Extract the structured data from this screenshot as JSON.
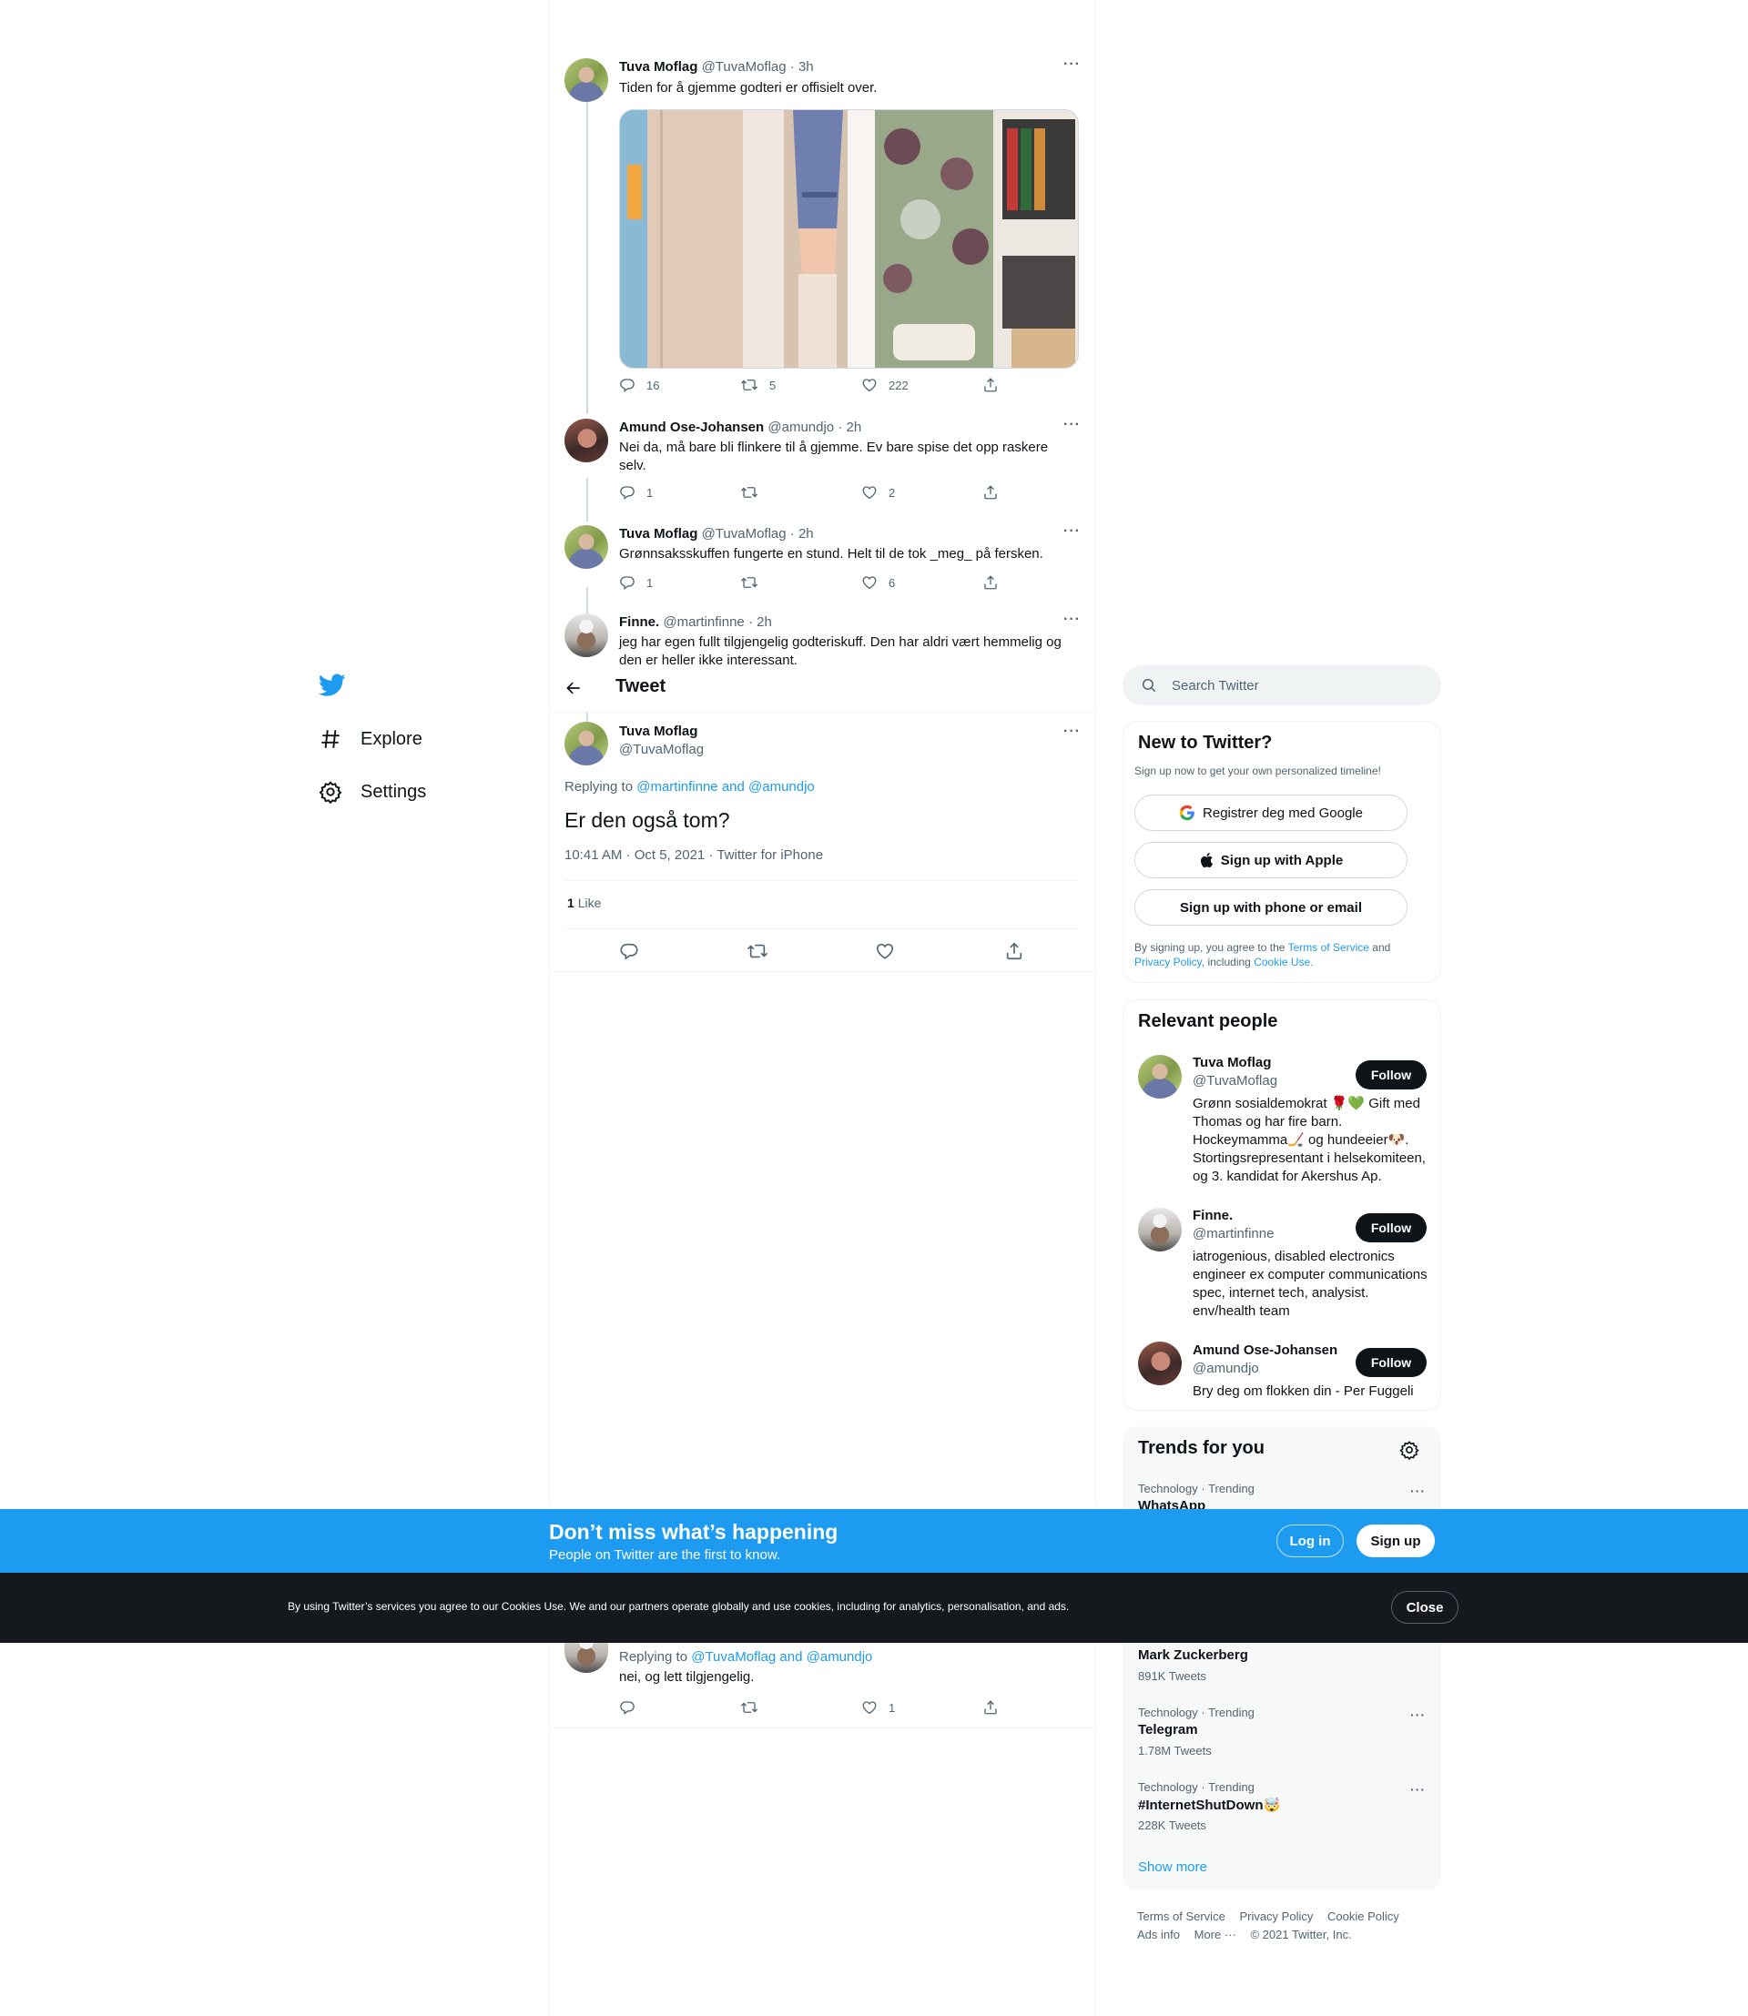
{
  "nav": {
    "explore": "Explore",
    "settings": "Settings"
  },
  "header": {
    "title": "Tweet"
  },
  "thread": [
    {
      "name": "Tuva Moflag",
      "handle": "@TuvaMoflag",
      "time": "· 3h",
      "text": "Tiden for å gjemme godteri er offisielt over.",
      "replies": "16",
      "retweets": "5",
      "likes": "222"
    },
    {
      "name": "Amund Ose-Johansen",
      "handle": "@amundjo",
      "time": "· 2h",
      "text": "Nei da, må bare bli flinkere til å gjemme. Ev bare spise det opp raskere selv.",
      "replies": "1",
      "retweets": "",
      "likes": "2"
    },
    {
      "name": "Tuva Moflag",
      "handle": "@TuvaMoflag",
      "time": "· 2h",
      "text": "Grønnsaksskuffen fungerte en stund. Helt til de tok _meg_ på fersken.",
      "replies": "1",
      "retweets": "",
      "likes": "6"
    },
    {
      "name": "Finne.",
      "handle": "@martinfinne",
      "time": "· 2h",
      "text": "jeg har egen fullt tilgjengelig godteriskuff. Den har aldri vært hemmelig og den er heller ikke interessant."
    }
  ],
  "main_tweet": {
    "name": "Tuva Moflag",
    "handle": "@TuvaMoflag",
    "replying_prefix": "Replying to",
    "replying_to": "@martinfinne and @amundjo",
    "text": "Er den også tom?",
    "timestamp": "10:41 AM · Oct 5, 2021 · Twitter for iPhone",
    "like_count": "1",
    "like_label": "Like"
  },
  "reply_below": {
    "replying_prefix": "Replying to",
    "replying_to": "@TuvaMoflag and @amundjo",
    "text": "nei, og lett tilgjengelig.",
    "likes": "1"
  },
  "search": {
    "placeholder": "Search Twitter"
  },
  "signup": {
    "title": "New to Twitter?",
    "subtitle": "Sign up now to get your own personalized timeline!",
    "google": "Registrer deg med Google",
    "apple": "Sign up with Apple",
    "phone": "Sign up with phone or email",
    "legal_1": "By signing up, you agree to the",
    "terms": "Terms of Service",
    "and": "and",
    "privacy": "Privacy Policy",
    "including": ", including",
    "cookie": "Cookie Use."
  },
  "relevant": {
    "title": "Relevant people",
    "follow_label": "Follow",
    "people": [
      {
        "name": "Tuva Moflag",
        "handle": "@TuvaMoflag",
        "bio": "Grønn sosialdemokrat 🌹💚 Gift med Thomas og har fire barn. Hockeymamma🏒 og hundeeier🐶. Stortingsrepresentant i helsekomiteen, og 3. kandidat for Akershus Ap."
      },
      {
        "name": "Finne.",
        "handle": "@martinfinne",
        "bio": "iatrogenious, disabled electronics engineer ex computer communications spec, internet tech, analysist. env/health team"
      },
      {
        "name": "Amund Ose-Johansen",
        "handle": "@amundjo",
        "bio": "Bry deg om flokken din - Per Fuggeli"
      }
    ]
  },
  "trends": {
    "title": "Trends for you",
    "items": [
      {
        "meta": "Technology · Trending",
        "name": "WhatsApp",
        "count": ""
      },
      {
        "meta": "",
        "name": "Mark Zuckerberg",
        "count": "891K Tweets"
      },
      {
        "meta": "Technology · Trending",
        "name": "Telegram",
        "count": "1.78M Tweets"
      },
      {
        "meta": "Technology · Trending",
        "name": "#InternetShutDown🤯",
        "count": "228K Tweets"
      }
    ],
    "show_more": "Show more"
  },
  "footer": {
    "links": [
      "Terms of Service",
      "Privacy Policy",
      "Cookie Policy",
      "Ads info",
      "More ···",
      "© 2021 Twitter, Inc."
    ]
  },
  "banner": {
    "title": "Don’t miss what’s happening",
    "subtitle": "People on Twitter are the first to know.",
    "login": "Log in",
    "signup": "Sign up"
  },
  "cookie_bar": {
    "text": "By using Twitter’s services you agree to our Cookies Use. We and our partners operate globally and use cookies, including for analytics, personalisation, and ads.",
    "close": "Close"
  },
  "colors": {
    "accent": "#1d9bf0",
    "text": "#0f1419",
    "muted": "#536471",
    "dark_bar": "#15191d"
  }
}
